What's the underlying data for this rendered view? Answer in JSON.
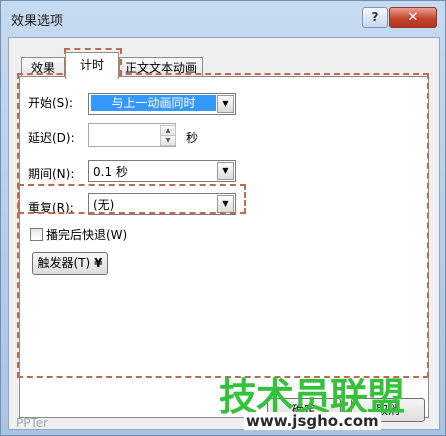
{
  "window": {
    "title": "效果选项",
    "help": "?",
    "close": "✕"
  },
  "tabs": [
    {
      "label": "效果"
    },
    {
      "label": "计时"
    },
    {
      "label": "正文文本动画"
    }
  ],
  "timing": {
    "start_label": "开始(S):",
    "start_value": "与上一动画同时",
    "delay_label": "延迟(D):",
    "delay_value": "",
    "delay_unit": "秒",
    "period_label": "期间(N):",
    "period_value": "0.1 秒",
    "repeat_label": "重复(R):",
    "repeat_value": "(无)",
    "rewind_label": "播完后快退(W)",
    "rewind_checked": false,
    "trigger_label": "触发器(T)",
    "trigger_arrow": "¥"
  },
  "footer": {
    "ok_label": "确定",
    "cancel_label": "取消"
  },
  "watermark": {
    "main": "技术员联盟",
    "url": "www.jsgho.com",
    "left": "PPTer"
  },
  "icons": {
    "dropdown": "chevron-down-icon",
    "spin_up": "spin-up-icon",
    "spin_down": "spin-down-icon"
  }
}
